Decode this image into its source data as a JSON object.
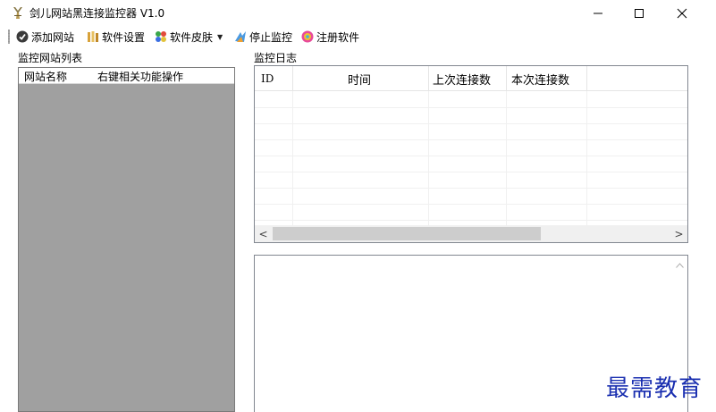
{
  "window": {
    "title": "剑儿网站黑连接监控器 V1.0",
    "controls": [
      "minimize",
      "maximize",
      "close"
    ]
  },
  "toolbar": {
    "items": [
      {
        "label": "添加网站",
        "icon": "add-site-icon"
      },
      {
        "label": "软件设置",
        "icon": "settings-icon"
      },
      {
        "label": "软件皮肤",
        "icon": "skin-icon",
        "has_dropdown": true
      },
      {
        "label": "停止监控",
        "icon": "stop-monitor-icon"
      },
      {
        "label": "注册软件",
        "icon": "register-icon"
      }
    ]
  },
  "left_panel": {
    "title": "监控网站列表",
    "columns": [
      "网站名称",
      "右键相关功能操作"
    ]
  },
  "log_panel": {
    "title": "监控日志",
    "columns": [
      "ID",
      "时间",
      "上次连接数",
      "本次连接数"
    ],
    "scroll_left": "<",
    "scroll_right": ">"
  },
  "watermark": "最需教育",
  "colors": {
    "list_background": "#a0a0a0",
    "watermark": "#1a2fb0",
    "scrollbar_thumb": "#cdcdcd"
  }
}
